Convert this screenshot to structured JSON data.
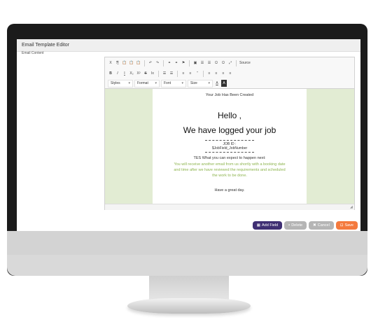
{
  "window": {
    "title": "Email Template Editor",
    "cut_label": "Email Content"
  },
  "toolbar": {
    "row1": [
      "X",
      "⎘",
      "📋",
      "📋",
      "📋",
      "↶",
      "↷",
      "⚭",
      "⚭",
      "⚑",
      "▣",
      "☰",
      "☰",
      "Ω",
      "Ω",
      "⤢"
    ],
    "source_label": "Source",
    "row2": [
      "B",
      "I",
      "I",
      "X₂",
      "X²",
      "S",
      "Ix",
      "☰",
      "☰",
      "≡",
      "≡",
      "”",
      "≡",
      "≡",
      "≡",
      "≡"
    ],
    "styles_label": "Styles",
    "format_label": "Format",
    "font_label": "Font",
    "size_label": "Size",
    "text_color_label": "A",
    "bg_color_label": "A"
  },
  "email": {
    "top_line": "Your Job Has Been Created",
    "hello": "Hello ,",
    "logged": "We have logged your job",
    "job_id": "JOB ID : $JobField_JobNumber",
    "expect": "TES What you can expect to happen next:",
    "green_text": "You will receive another email from us shortly with a booking date and time after we have reviewed the requirements and scheduled the work to be done.",
    "closing": "Have a great day."
  },
  "footer": {
    "add_field": "Add Field",
    "delete": "Delete",
    "cancel": "Cancel",
    "save": "Save"
  },
  "colors": {
    "accent": "#3f2f73",
    "save": "#f47a3e",
    "green_text": "#8db44e",
    "canvas_bg": "#e2ecd3"
  }
}
